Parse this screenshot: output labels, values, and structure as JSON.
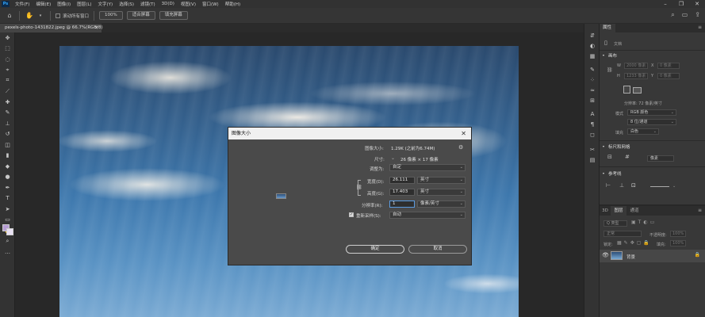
{
  "menu": {
    "logo": "Ps",
    "items": [
      "文件(F)",
      "编辑(E)",
      "图像(I)",
      "图层(L)",
      "文字(Y)",
      "选择(S)",
      "滤镜(T)",
      "3D(D)",
      "视图(V)",
      "窗口(W)",
      "帮助(H)"
    ],
    "window_controls": [
      "–",
      "❐",
      "✕"
    ]
  },
  "options_bar": {
    "tool_icon": "hand-icon",
    "scroll_all_windows": "滚动所有窗口",
    "zoom_100": "100%",
    "fit_screen": "适合屏幕",
    "fill_screen": "填充屏幕"
  },
  "document_tab": {
    "title": "pexels-photo-1431822.jpeg @ 66.7%(RGB/8)",
    "close": "×"
  },
  "dialog": {
    "title": "图像大小",
    "close": "✕",
    "image_size_label": "图像大小:",
    "image_size_value": "1.29K (之前为6.74M)",
    "dimensions_label": "尺寸:",
    "dimensions_value": "26 像素 × 17 像素",
    "fit_to_label": "调整为:",
    "fit_to_value": "自定",
    "width_label": "宽度(D):",
    "width_value": "26.111",
    "width_unit": "英寸",
    "height_label": "高度(G):",
    "height_value": "17.403",
    "height_unit": "英寸",
    "resolution_label": "分辨率(R):",
    "resolution_value": "1",
    "resolution_unit": "像素/英寸",
    "resample_label": "重新采样(S):",
    "resample_value": "自动",
    "ok_label": "确定",
    "cancel_label": "取消"
  },
  "properties": {
    "tab": "属性",
    "doc_label": "文档",
    "canvas_header": "画布",
    "w_label": "W",
    "w_value": "2000 像素",
    "x_label": "X",
    "x_value": "0 像素",
    "h_label": "H",
    "h_value": "1233 像素",
    "y_label": "Y",
    "y_value": "0 像素",
    "resolution_text": "分辨率: 72 像素/英寸",
    "mode_label": "模式",
    "mode_value": "RGB 颜色",
    "depth_value": "8 位/通道",
    "fill_label": "填充",
    "fill_value": "白色",
    "rulers_header": "标尺和网格",
    "rulers_value": "像素",
    "guides_header": "参考线"
  },
  "layers": {
    "tabs": [
      "3D",
      "图层",
      "通道"
    ],
    "kind_placeholder": "Q 类型",
    "blend_mode": "正常",
    "opacity_label": "不透明度:",
    "opacity_value": "100%",
    "lock_label": "锁定:",
    "fill_label": "填充:",
    "fill_value": "100%",
    "layer_name": "背景"
  },
  "colors": {
    "foreground": "#b59cd3",
    "background": "#e8e0f2",
    "accent": "#5b9be0"
  }
}
